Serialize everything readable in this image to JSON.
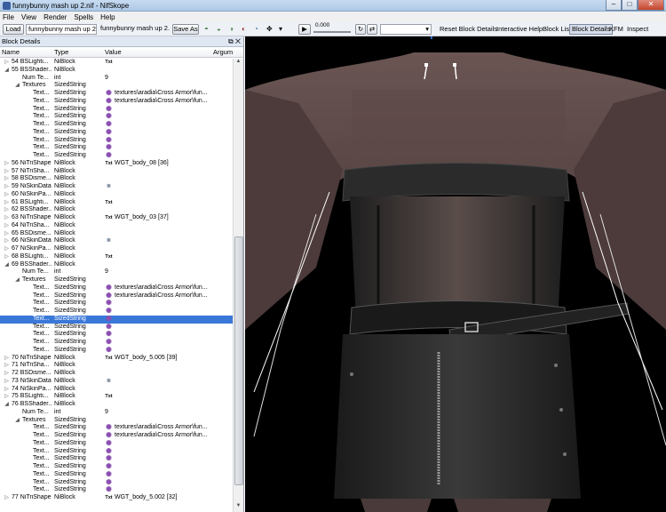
{
  "window": {
    "title": "funnybunny mash up 2.nif - NifSkope"
  },
  "menu": [
    "File",
    "View",
    "Render",
    "Spells",
    "Help"
  ],
  "toolbar": {
    "load_label": "Load",
    "file_value": "funnybunny mash up 2.nif",
    "file_value2": "funnybunny mash up 2.nif",
    "save_label": "Save As",
    "time_value": "0.000",
    "reset_label": "Reset Block Details",
    "interactive_help_label": "Interactive Help",
    "block_list_label": "Block List",
    "block_details_label": "Block Details",
    "kfm_label": "KFM",
    "inspect_label": "Inspect"
  },
  "panel": {
    "title": "Block Details",
    "columns": [
      "Name",
      "Type",
      "Value",
      "Argum"
    ],
    "rows": [
      {
        "exp": "▷",
        "indent": 0,
        "name": "54 BSLighti...",
        "type": "NiBlock",
        "icon": "txt",
        "value": ""
      },
      {
        "exp": "◢",
        "indent": 0,
        "name": "55 BSShader...",
        "type": "NiBlock",
        "icon": "",
        "value": ""
      },
      {
        "exp": "",
        "indent": 1,
        "name": "Num Te...",
        "type": "int",
        "icon": "",
        "value": "9"
      },
      {
        "exp": "◢",
        "indent": 1,
        "name": "Textures",
        "type": "SizedString",
        "icon": "",
        "value": ""
      },
      {
        "exp": "",
        "indent": 2,
        "name": "Text...",
        "type": "SizedString",
        "icon": "img",
        "value": "textures\\aradia\\Cross Armor\\fun..."
      },
      {
        "exp": "",
        "indent": 2,
        "name": "Text...",
        "type": "SizedString",
        "icon": "img",
        "value": "textures\\aradia\\Cross Armor\\fun..."
      },
      {
        "exp": "",
        "indent": 2,
        "name": "Text...",
        "type": "SizedString",
        "icon": "img",
        "value": ""
      },
      {
        "exp": "",
        "indent": 2,
        "name": "Text...",
        "type": "SizedString",
        "icon": "img",
        "value": ""
      },
      {
        "exp": "",
        "indent": 2,
        "name": "Text...",
        "type": "SizedString",
        "icon": "img",
        "value": ""
      },
      {
        "exp": "",
        "indent": 2,
        "name": "Text...",
        "type": "SizedString",
        "icon": "img",
        "value": ""
      },
      {
        "exp": "",
        "indent": 2,
        "name": "Text...",
        "type": "SizedString",
        "icon": "img",
        "value": ""
      },
      {
        "exp": "",
        "indent": 2,
        "name": "Text...",
        "type": "SizedString",
        "icon": "img",
        "value": ""
      },
      {
        "exp": "",
        "indent": 2,
        "name": "Text...",
        "type": "SizedString",
        "icon": "img",
        "value": ""
      },
      {
        "exp": "▷",
        "indent": 0,
        "name": "56 NiTriShape",
        "type": "NiBlock",
        "icon": "txt",
        "value": "WGT_body_08 [36]"
      },
      {
        "exp": "▷",
        "indent": 0,
        "name": "57 NiTriSha...",
        "type": "NiBlock",
        "icon": "",
        "value": ""
      },
      {
        "exp": "▷",
        "indent": 0,
        "name": "58 BSDisme...",
        "type": "NiBlock",
        "icon": "",
        "value": ""
      },
      {
        "exp": "▷",
        "indent": 0,
        "name": "59 NiSkinData",
        "type": "NiBlock",
        "icon": "sk",
        "value": ""
      },
      {
        "exp": "▷",
        "indent": 0,
        "name": "60 NiSkinPa...",
        "type": "NiBlock",
        "icon": "",
        "value": ""
      },
      {
        "exp": "▷",
        "indent": 0,
        "name": "61 BSLighti...",
        "type": "NiBlock",
        "icon": "txt",
        "value": ""
      },
      {
        "exp": "▷",
        "indent": 0,
        "name": "62 BSShader...",
        "type": "NiBlock",
        "icon": "",
        "value": ""
      },
      {
        "exp": "▷",
        "indent": 0,
        "name": "63 NiTriShape",
        "type": "NiBlock",
        "icon": "txt",
        "value": "WGT_body_03 [37]"
      },
      {
        "exp": "▷",
        "indent": 0,
        "name": "64 NiTriSha...",
        "type": "NiBlock",
        "icon": "",
        "value": ""
      },
      {
        "exp": "▷",
        "indent": 0,
        "name": "65 BSDisme...",
        "type": "NiBlock",
        "icon": "",
        "value": ""
      },
      {
        "exp": "▷",
        "indent": 0,
        "name": "66 NiSkinData",
        "type": "NiBlock",
        "icon": "sk",
        "value": ""
      },
      {
        "exp": "▷",
        "indent": 0,
        "name": "67 NiSkinPa...",
        "type": "NiBlock",
        "icon": "",
        "value": ""
      },
      {
        "exp": "▷",
        "indent": 0,
        "name": "68 BSLighti...",
        "type": "NiBlock",
        "icon": "txt",
        "value": ""
      },
      {
        "exp": "◢",
        "indent": 0,
        "name": "69 BSShader...",
        "type": "NiBlock",
        "icon": "",
        "value": ""
      },
      {
        "exp": "",
        "indent": 1,
        "name": "Num Te...",
        "type": "int",
        "icon": "",
        "value": "9"
      },
      {
        "exp": "◢",
        "indent": 1,
        "name": "Textures",
        "type": "SizedString",
        "icon": "",
        "value": ""
      },
      {
        "exp": "",
        "indent": 2,
        "name": "Text...",
        "type": "SizedString",
        "icon": "img",
        "value": "textures\\aradia\\Cross Armor\\fun..."
      },
      {
        "exp": "",
        "indent": 2,
        "name": "Text...",
        "type": "SizedString",
        "icon": "img",
        "value": "textures\\aradia\\Cross Armor\\fun..."
      },
      {
        "exp": "",
        "indent": 2,
        "name": "Text...",
        "type": "SizedString",
        "icon": "img",
        "value": ""
      },
      {
        "exp": "",
        "indent": 2,
        "name": "Text...",
        "type": "SizedString",
        "icon": "img",
        "value": ""
      },
      {
        "exp": "",
        "indent": 2,
        "name": "Text...",
        "type": "SizedString",
        "icon": "img",
        "value": "",
        "selected": true
      },
      {
        "exp": "",
        "indent": 2,
        "name": "Text...",
        "type": "SizedString",
        "icon": "img",
        "value": ""
      },
      {
        "exp": "",
        "indent": 2,
        "name": "Text...",
        "type": "SizedString",
        "icon": "img",
        "value": ""
      },
      {
        "exp": "",
        "indent": 2,
        "name": "Text...",
        "type": "SizedString",
        "icon": "img",
        "value": ""
      },
      {
        "exp": "",
        "indent": 2,
        "name": "Text...",
        "type": "SizedString",
        "icon": "img",
        "value": ""
      },
      {
        "exp": "▷",
        "indent": 0,
        "name": "70 NiTriShape",
        "type": "NiBlock",
        "icon": "txt",
        "value": "WGT_body_5.005 [39]"
      },
      {
        "exp": "▷",
        "indent": 0,
        "name": "71 NiTriSha...",
        "type": "NiBlock",
        "icon": "",
        "value": ""
      },
      {
        "exp": "▷",
        "indent": 0,
        "name": "72 BSDisme...",
        "type": "NiBlock",
        "icon": "",
        "value": ""
      },
      {
        "exp": "▷",
        "indent": 0,
        "name": "73 NiSkinData",
        "type": "NiBlock",
        "icon": "sk",
        "value": ""
      },
      {
        "exp": "▷",
        "indent": 0,
        "name": "74 NiSkinPa...",
        "type": "NiBlock",
        "icon": "",
        "value": ""
      },
      {
        "exp": "▷",
        "indent": 0,
        "name": "75 BSLighti...",
        "type": "NiBlock",
        "icon": "txt",
        "value": ""
      },
      {
        "exp": "◢",
        "indent": 0,
        "name": "76 BSShader...",
        "type": "NiBlock",
        "icon": "",
        "value": ""
      },
      {
        "exp": "",
        "indent": 1,
        "name": "Num Te...",
        "type": "int",
        "icon": "",
        "value": "9"
      },
      {
        "exp": "◢",
        "indent": 1,
        "name": "Textures",
        "type": "SizedString",
        "icon": "",
        "value": ""
      },
      {
        "exp": "",
        "indent": 2,
        "name": "Text...",
        "type": "SizedString",
        "icon": "img",
        "value": "textures\\aradia\\Cross Armor\\fun..."
      },
      {
        "exp": "",
        "indent": 2,
        "name": "Text...",
        "type": "SizedString",
        "icon": "img",
        "value": "textures\\aradia\\Cross Armor\\fun..."
      },
      {
        "exp": "",
        "indent": 2,
        "name": "Text...",
        "type": "SizedString",
        "icon": "img",
        "value": ""
      },
      {
        "exp": "",
        "indent": 2,
        "name": "Text...",
        "type": "SizedString",
        "icon": "img",
        "value": ""
      },
      {
        "exp": "",
        "indent": 2,
        "name": "Text...",
        "type": "SizedString",
        "icon": "img",
        "value": ""
      },
      {
        "exp": "",
        "indent": 2,
        "name": "Text...",
        "type": "SizedString",
        "icon": "img",
        "value": ""
      },
      {
        "exp": "",
        "indent": 2,
        "name": "Text...",
        "type": "SizedString",
        "icon": "img",
        "value": ""
      },
      {
        "exp": "",
        "indent": 2,
        "name": "Text...",
        "type": "SizedString",
        "icon": "img",
        "value": ""
      },
      {
        "exp": "",
        "indent": 2,
        "name": "Text...",
        "type": "SizedString",
        "icon": "img",
        "value": ""
      },
      {
        "exp": "▷",
        "indent": 0,
        "name": "77 NiTriShape",
        "type": "NiBlock",
        "icon": "txt",
        "value": "WGT_body_5.002 [32]"
      }
    ]
  },
  "colors": {
    "selection": "#3a78d8",
    "viewport_bg": "#000000",
    "skin": "#5e4a48",
    "outfit": "#2a2a2a"
  }
}
